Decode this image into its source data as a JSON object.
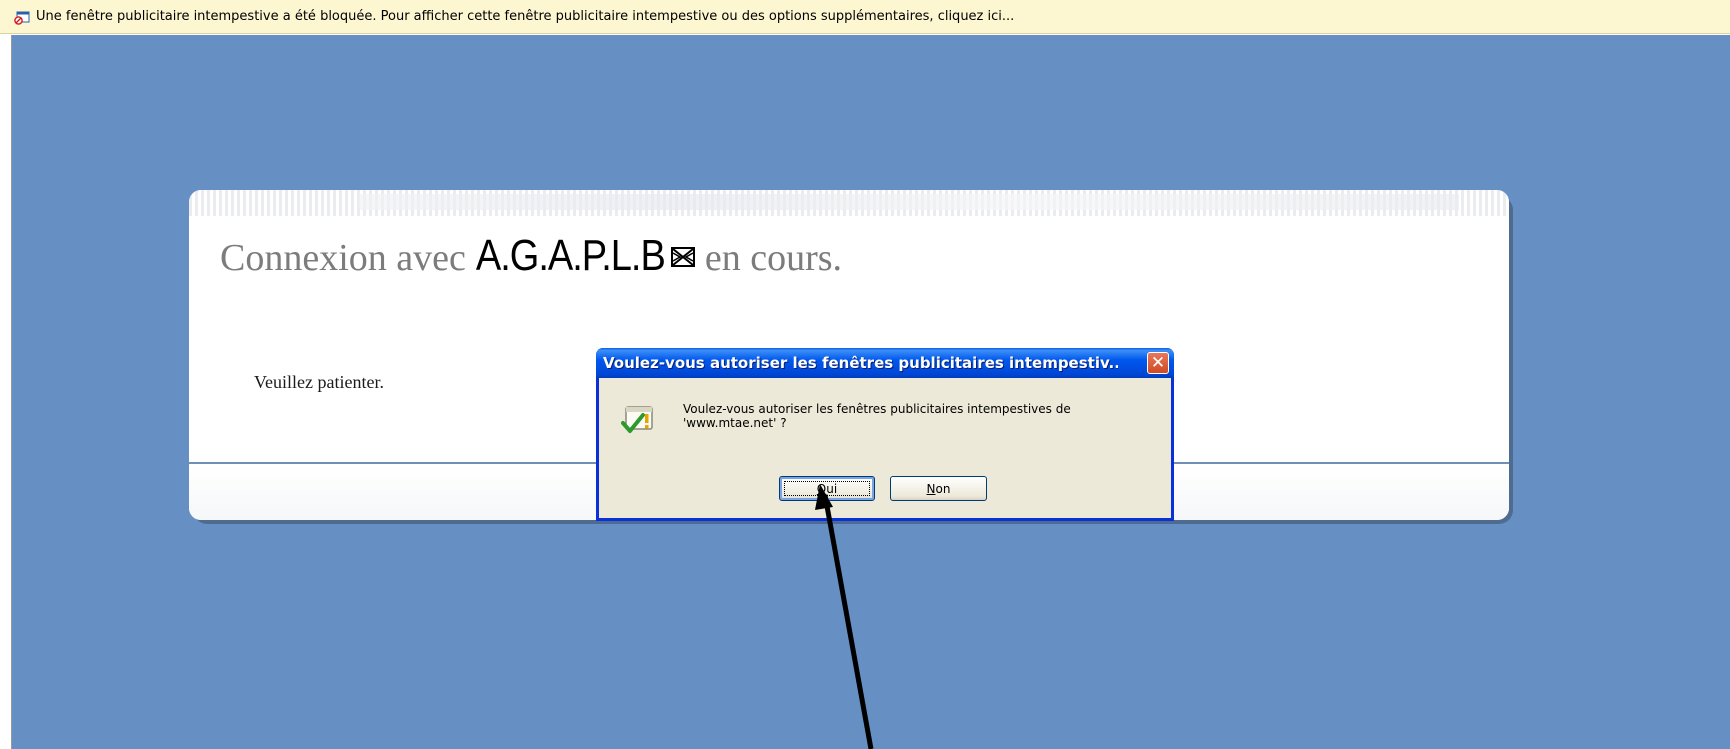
{
  "infobar": {
    "message": "Une fenêtre publicitaire intempestive a été bloquée. Pour afficher cette fenêtre publicitaire intempestive ou des options supplémentaires, cliquez ici..."
  },
  "page": {
    "connexion_prefix": "Connexion avec",
    "brand": "A.G.A.P.L.B",
    "connexion_suffix": "en cours.",
    "wait_message": "Veuillez patienter."
  },
  "dialog": {
    "title": "Voulez-vous autoriser les fenêtres publicitaires intempestiv...",
    "message_line1": "Voulez-vous autoriser les fenêtres publicitaires intempestives de",
    "message_line2": "'www.mtae.net' ?",
    "yes": {
      "accesskey": "O",
      "rest": "ui"
    },
    "no": {
      "accesskey": "N",
      "rest": "on"
    },
    "close_glyph": "✕"
  },
  "colors": {
    "page_background": "#6690c3",
    "infobar_background": "#fcf7d1",
    "titlebar_blue": "#0058ee",
    "dialog_face": "#ece9d8"
  },
  "icons": [
    "popup-blocked-icon",
    "brand-logo-icon",
    "warning-check-icon",
    "close-icon",
    "pointer-arrow"
  ]
}
